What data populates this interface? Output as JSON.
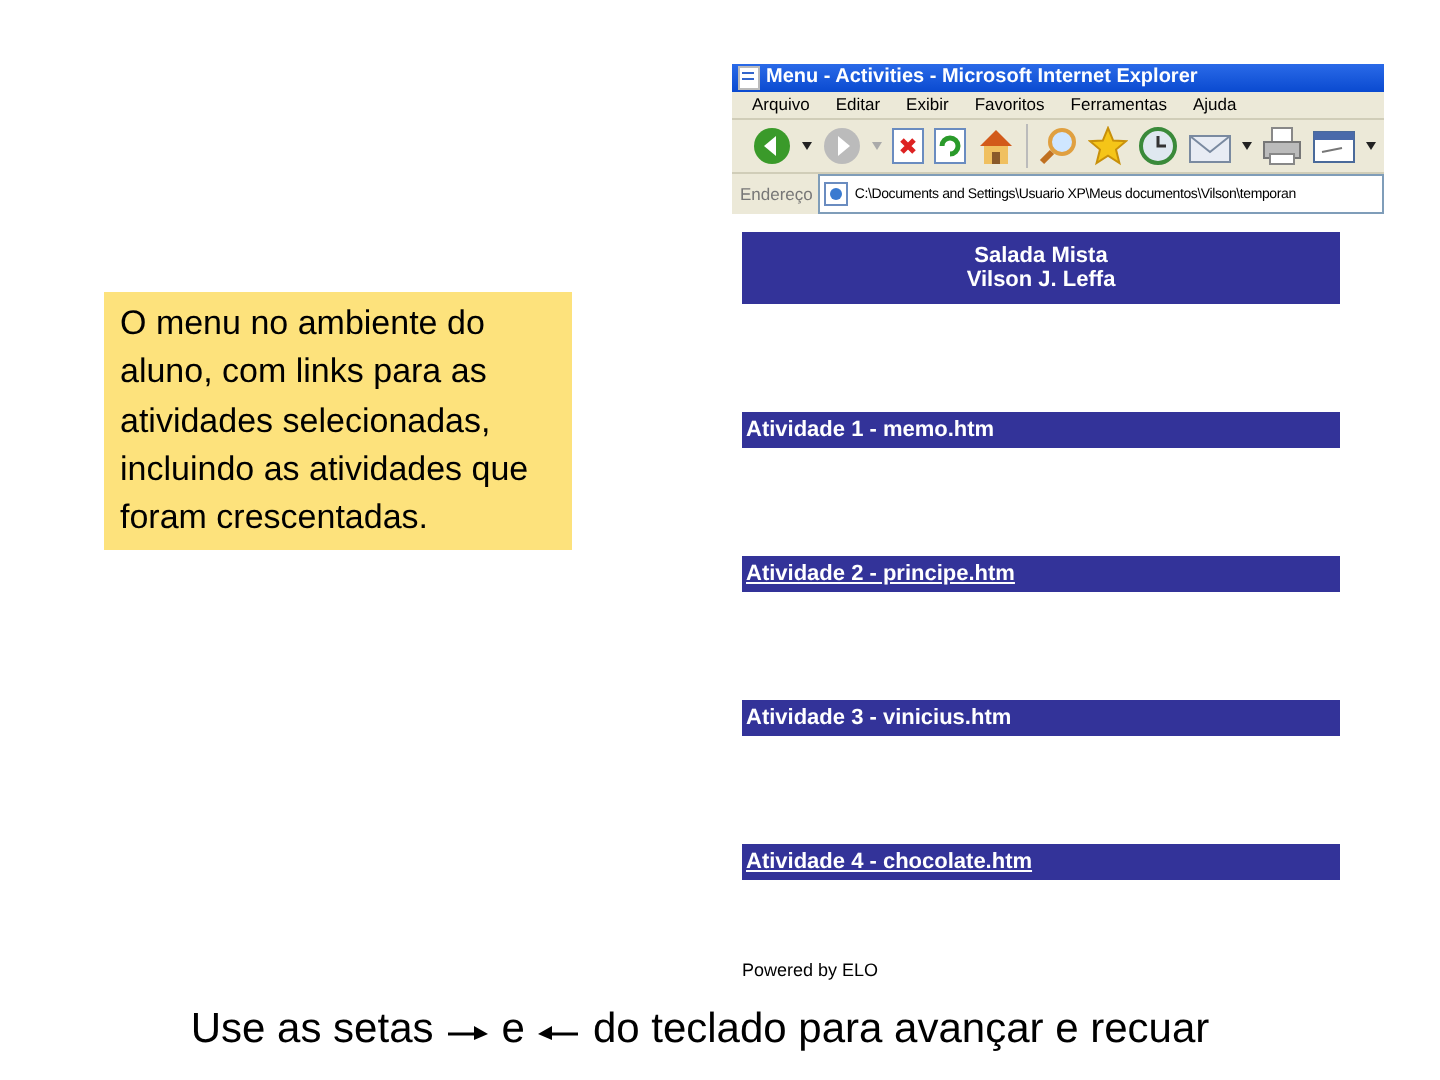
{
  "callout": {
    "text": "O menu no ambiente do aluno, com links para as atividades selecionadas, incluindo as atividades que foram crescentadas."
  },
  "browser": {
    "title": "Menu - Activities - Microsoft Internet Explorer",
    "menu": [
      "Arquivo",
      "Editar",
      "Exibir",
      "Favoritos",
      "Ferramentas",
      "Ajuda"
    ],
    "address_label": "Endereço",
    "address": "C:\\Documents and Settings\\Usuario XP\\Meus documentos\\Vilson\\temporan"
  },
  "page": {
    "header": [
      "Salada Mista",
      "Vilson J. Leffa"
    ],
    "links": [
      {
        "label": "Atividade 1 - memo.htm",
        "underlined": false
      },
      {
        "label": "Atividade 2 - principe.htm",
        "underlined": true
      },
      {
        "label": "Atividade 3 - vinicius.htm",
        "underlined": false
      },
      {
        "label": "Atividade 4 - chocolate.htm",
        "underlined": true
      }
    ],
    "footer": "Powered by ELO"
  },
  "caption": {
    "before": "Use as setas",
    "middle": "e",
    "after": "do teclado para avançar e recuar"
  }
}
